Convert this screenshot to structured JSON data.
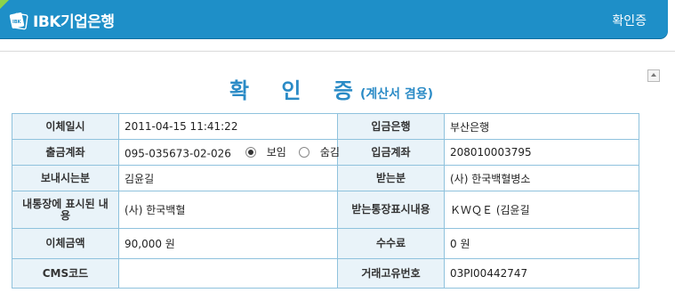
{
  "header": {
    "logo_text": "IBK기업은행",
    "logo_mark_text": "IBK",
    "title": "확인증"
  },
  "document": {
    "title": "확 인 증",
    "subtitle": "(계산서 겸용)"
  },
  "transfer": {
    "date_label": "이체일시",
    "date_value": "2011-04-15 11:41:22",
    "deposit_bank_label": "입금은행",
    "deposit_bank_value": "부산은행",
    "withdraw_account_label": "출금계좌",
    "withdraw_account_value": "095-035673-02-026",
    "show_option_label": "보임",
    "hide_option_label": "숨김",
    "selected_option": "보임",
    "deposit_account_label": "입금계좌",
    "deposit_account_value": "208010003795",
    "sender_label": "보내시는분",
    "sender_value": "김윤길",
    "recipient_label": "받는분",
    "recipient_value": "(사) 한국백혈병소",
    "my_memo_label": "내통장에 표시된 내용",
    "my_memo_value": "(사) 한국백혈",
    "recipient_memo_label": "받는통장표시내용",
    "recipient_memo_value": "ＫＷＱＥ (김윤길",
    "amount_label": "이체금액",
    "amount_value": "90,000 원",
    "fee_label": "수수료",
    "fee_value": "0 원",
    "cms_label": "CMS코드",
    "cms_value": "",
    "transaction_id_label": "거래고유번호",
    "transaction_id_value": "03PI00442747"
  },
  "colors": {
    "header_bg": "#1e8fc8",
    "title_blue": "#2b8bc6",
    "label_bg": "#e9f3f9",
    "border": "#8fc2dd"
  },
  "icons": {
    "logo": "ibk-logo-icon",
    "scroll": "scroll-up-arrow-icon"
  }
}
